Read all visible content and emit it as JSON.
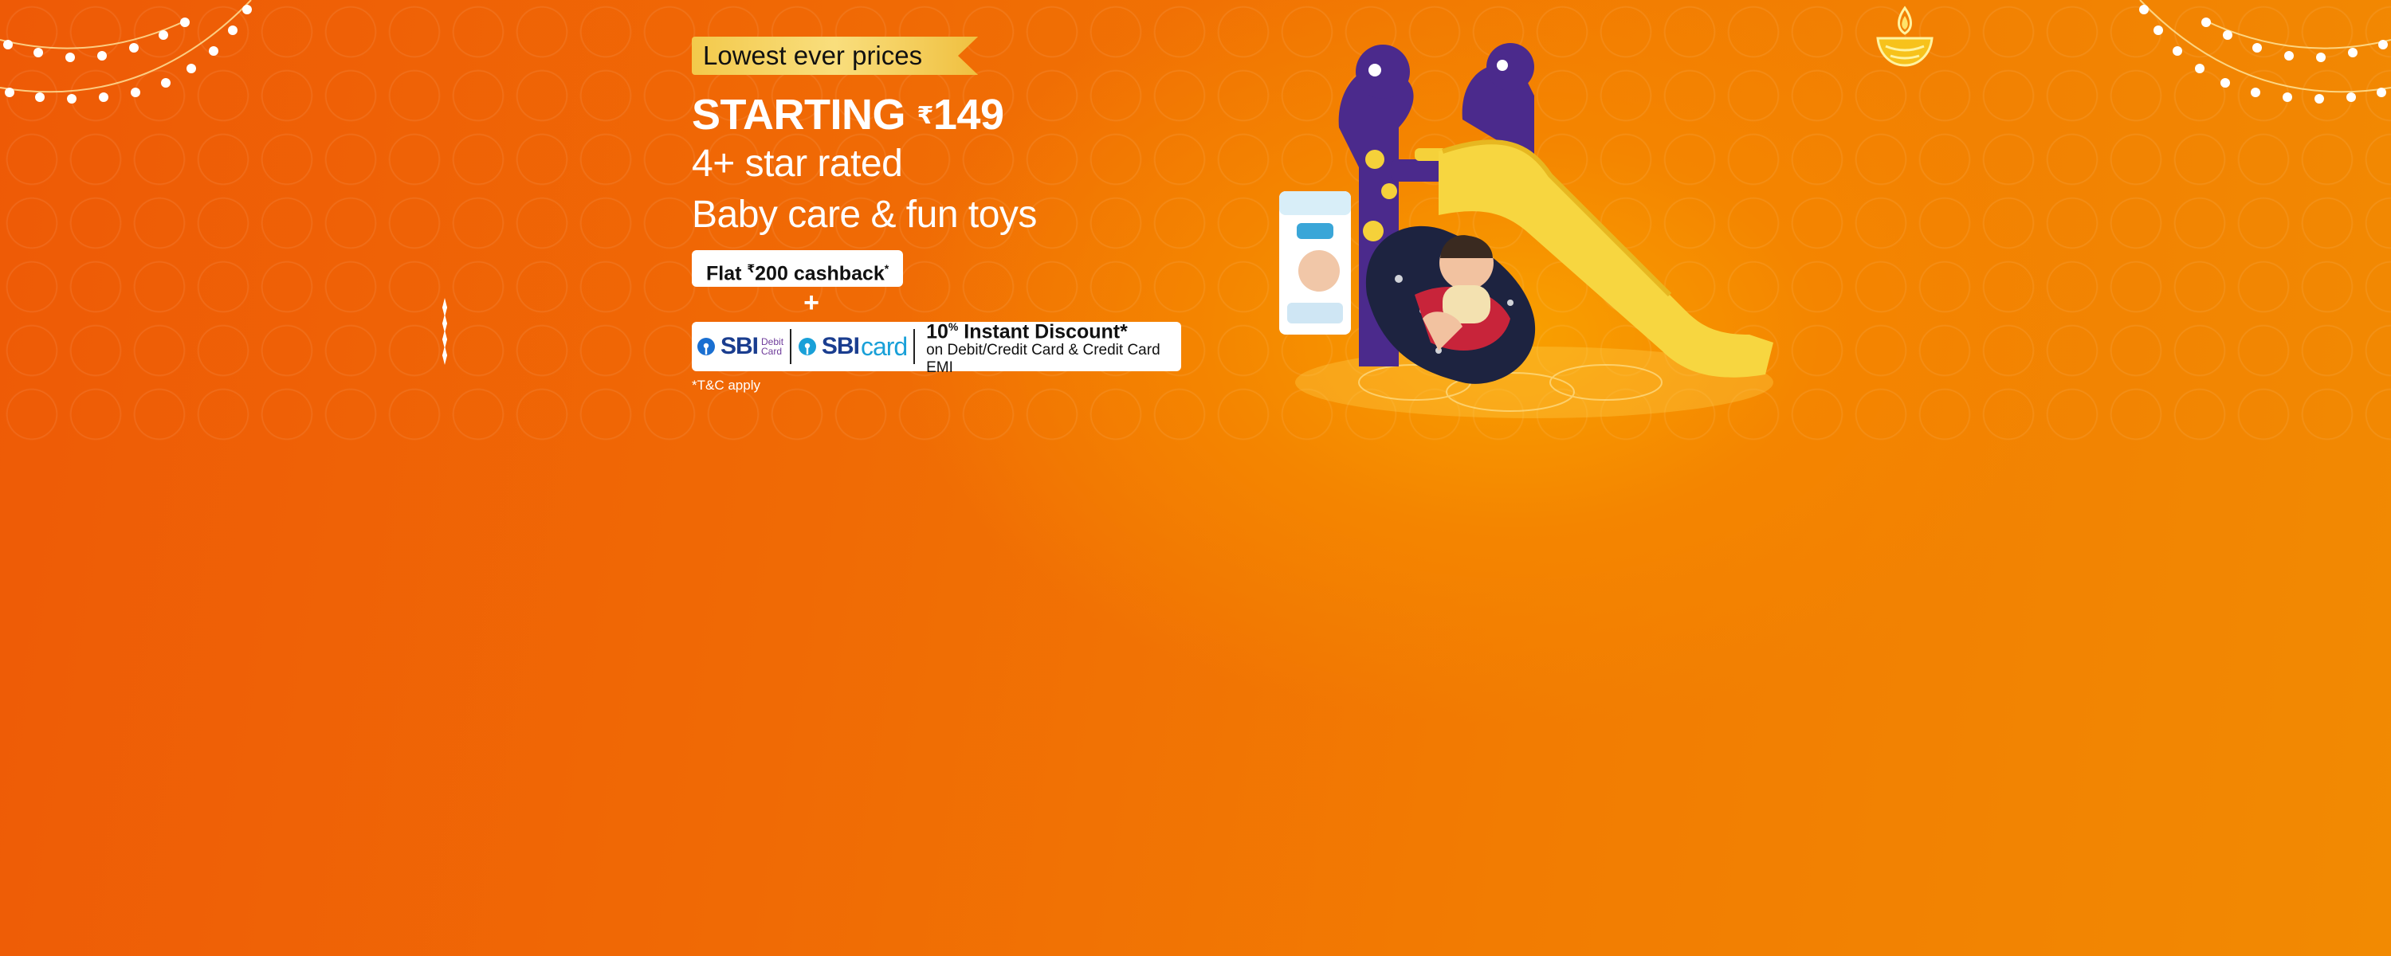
{
  "banner": {
    "ribbon_text": "Lowest ever prices",
    "starting_label": "STARTING",
    "rupee_symbol": "₹",
    "starting_price": "149",
    "headline_line1": "4+ star rated",
    "headline_line2": "Baby care & fun toys",
    "cashback_prefix": "Flat ",
    "cashback_rupee": "₹",
    "cashback_text": "200 cashback",
    "cashback_star": "*",
    "plus": "+",
    "sbi_debit_word": "SBI",
    "sbi_debit_small1": "Debit",
    "sbi_debit_small2": "Card",
    "sbi_card_word1": "SBI",
    "sbi_card_word2": "card",
    "discount_value": "10",
    "discount_unit": "%",
    "discount_label": " Instant Discount*",
    "discount_sub": "on Debit/Credit Card & Credit Card EMI",
    "tnc": "*T&C apply"
  },
  "colors": {
    "background_left": "#ee5a06",
    "background_right": "#f28a02",
    "ribbon_gold": "#f3c94b",
    "sbi_blue": "#1a3d8f",
    "sbi_card_cyan": "#19a0d8",
    "slide_yellow": "#f7d640",
    "toy_purple": "#4b2a8c"
  },
  "icons": {
    "lights": "festive-string-lights-icon",
    "diya": "diya-lamp-icon",
    "sparkle": "sparkle-icon",
    "sbi_logo": "sbi-logo-icon"
  }
}
